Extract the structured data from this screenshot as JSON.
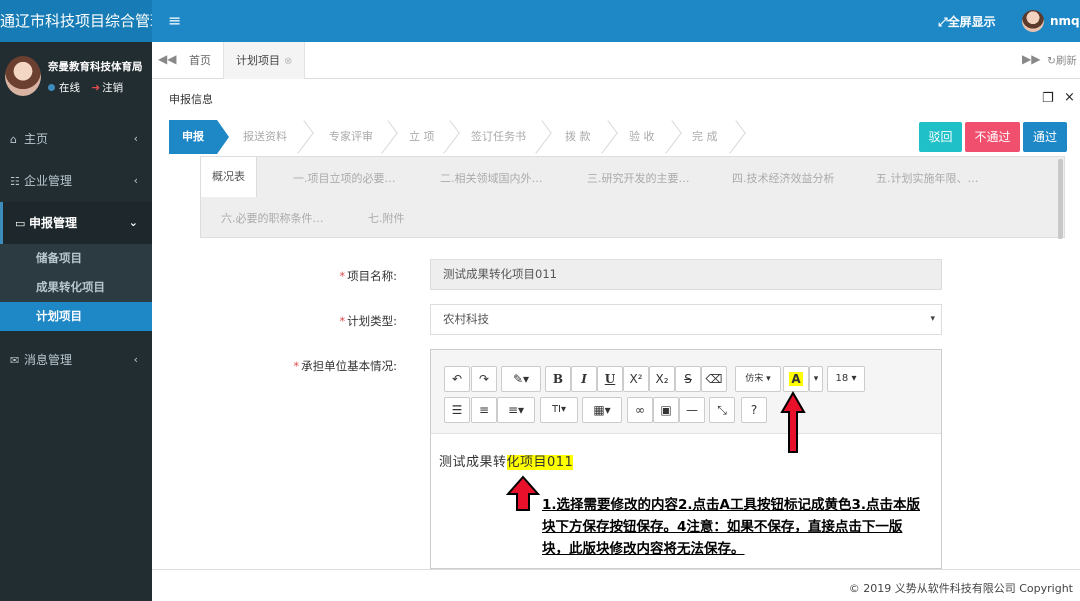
{
  "app": {
    "title": "通辽市科技项目综合管理信",
    "fullscreen_label": "全屏显示",
    "username": "nmq"
  },
  "user_panel": {
    "name": "奈曼教育科技体育局",
    "status": "在线",
    "logout": "注销"
  },
  "sidebar": {
    "items": [
      {
        "label": "主页",
        "icon": "home-icon"
      },
      {
        "label": "企业管理",
        "icon": "users-icon"
      },
      {
        "label": "申报管理",
        "icon": "card-icon"
      },
      {
        "label": "消息管理",
        "icon": "chat-icon"
      }
    ],
    "sub_items": [
      {
        "label": "储备项目"
      },
      {
        "label": "成果转化项目"
      },
      {
        "label": "计划项目"
      }
    ]
  },
  "tabs": {
    "home": "首页",
    "plan": "计划项目",
    "refresh": "刷新"
  },
  "panel": {
    "title": "申报信息"
  },
  "steps": [
    "申报",
    "报送资料",
    "专家评审",
    "立 项",
    "签订任务书",
    "拨 款",
    "验 收",
    "完 成"
  ],
  "actions": {
    "reject": "驳回",
    "not_pass": "不通过",
    "pass": "通过"
  },
  "subtabs": [
    "概况表",
    "一.项目立项的必要…",
    "二.相关领域国内外…",
    "三.研究开发的主要…",
    "四.技术经济效益分析",
    "五.计划实施年限、…",
    "六.必要的职称条件…",
    "七.附件"
  ],
  "form": {
    "project_name_label": "项目名称:",
    "project_name_value": "测试成果转化项目011",
    "plan_type_label": "计划类型:",
    "plan_type_value": "农村科技",
    "unit_label": "承担单位基本情况:"
  },
  "editor": {
    "font_label": "仿宋",
    "size_label": "18",
    "text_plain": "测试成果转",
    "text_highlight": "化项目011"
  },
  "instruction": "1.选择需要修改的内容2.点击A工具按钮标记成黄色3.点击本版块下方保存按钮保存。4注意：如果不保存，直接点击下一版块，此版块修改内容将无法保存。",
  "footer": {
    "copyright": "© 2019 义势从软件科技有限公司 Copyright"
  },
  "colors": {
    "brand": "#1e88c7",
    "reject": "#1fc0c7",
    "not_pass": "#f0506e",
    "highlight": "#ffff00"
  }
}
